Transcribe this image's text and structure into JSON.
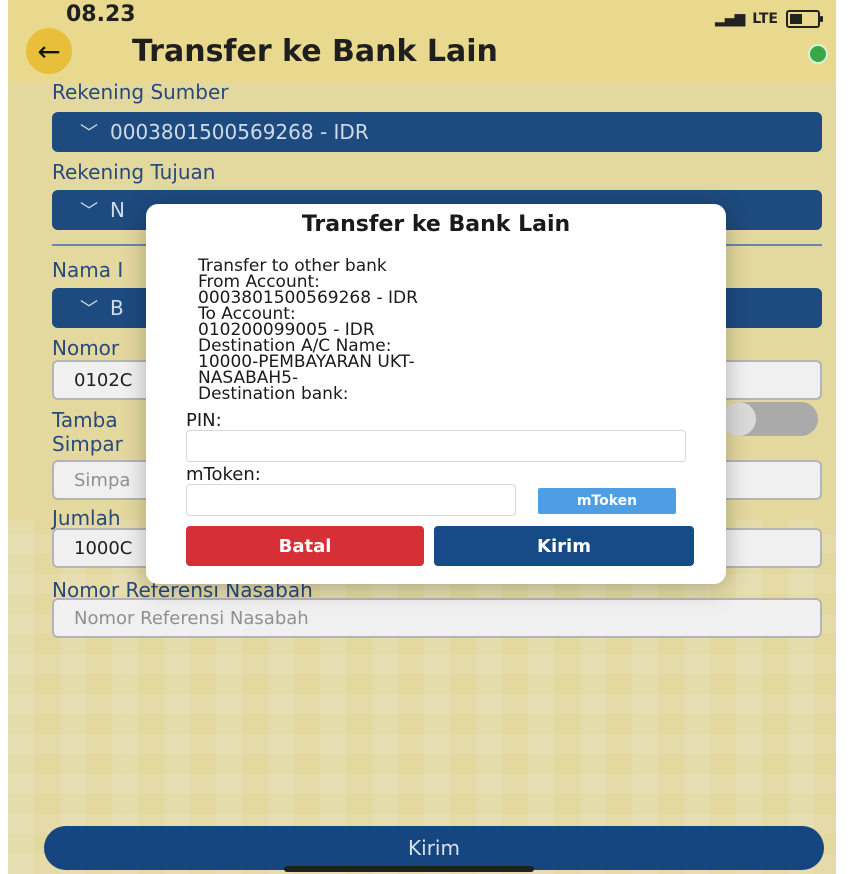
{
  "status": {
    "time": "08.23",
    "network": "LTE"
  },
  "header": {
    "back_icon": "back-arrow-icon",
    "title": "Transfer ke Bank Lain"
  },
  "form": {
    "source_label": "Rekening Sumber",
    "source_value": "0003801500569268 - IDR",
    "dest_label": "Rekening Tujuan",
    "dest_value": "N",
    "name_label": "Nama I",
    "name_value": "B",
    "number_label": "Nomor",
    "number_value": "0102C",
    "save_label_1": "Tamba",
    "save_label_2": "Simpar",
    "save_input_placeholder": "Simpa",
    "amount_label": "Jumlah",
    "amount_value": "1000C",
    "ref_label": "Nomor Referensi Nasabah",
    "ref_placeholder": "Nomor Referensi Nasabah",
    "submit_label": "Kirim"
  },
  "modal": {
    "title": "Transfer ke Bank Lain",
    "lines": [
      "Transfer to other bank",
      "From Account:",
      "0003801500569268 - IDR",
      "To Account:",
      "010200099005 - IDR",
      "Destination A/C Name:",
      "10000-PEMBAYARAN UKT-",
      "NASABAH5-",
      "Destination bank:"
    ],
    "pin_label": "PIN:",
    "mtoken_label": "mToken:",
    "mtoken_button": "mToken",
    "cancel_label": "Batal",
    "send_label": "Kirim"
  },
  "colors": {
    "primary_blue": "#174b88",
    "cancel_red": "#d62f36",
    "mtoken_blue": "#4e9ee3",
    "background_gold": "#f2e6a8"
  }
}
